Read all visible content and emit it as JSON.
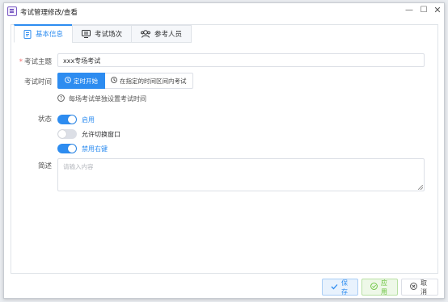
{
  "window": {
    "title": "考试管理修改/查看",
    "controls": {
      "minimize": "—",
      "maximize": "☐",
      "close": "✕"
    }
  },
  "tabs": [
    {
      "label": "基本信息",
      "icon": "document-icon",
      "active": true
    },
    {
      "label": "考试场次",
      "icon": "monitor-icon",
      "active": false
    },
    {
      "label": "参考人员",
      "icon": "users-icon",
      "active": false
    }
  ],
  "form": {
    "subject_label": "考试主题",
    "subject_value": "xxx专场考试",
    "time_label": "考试时间",
    "time_options": [
      "定时开始",
      "在指定的时间区间内考试"
    ],
    "time_selected": "定时开始",
    "time_hint": "每场考试单独设置考试时间",
    "status_label": "状态",
    "switches": [
      {
        "label": "启用",
        "on": true
      },
      {
        "label": "允许切换窗口",
        "on": false
      },
      {
        "label": "禁用右键",
        "on": true
      }
    ],
    "desc_label": "简述",
    "desc_placeholder": "请输入内容"
  },
  "footer": {
    "save": "保存",
    "apply": "应用",
    "cancel": "取消"
  },
  "colors": {
    "primary": "#2d8cf0",
    "success": "#67c23a",
    "required": "#f56c6c"
  }
}
